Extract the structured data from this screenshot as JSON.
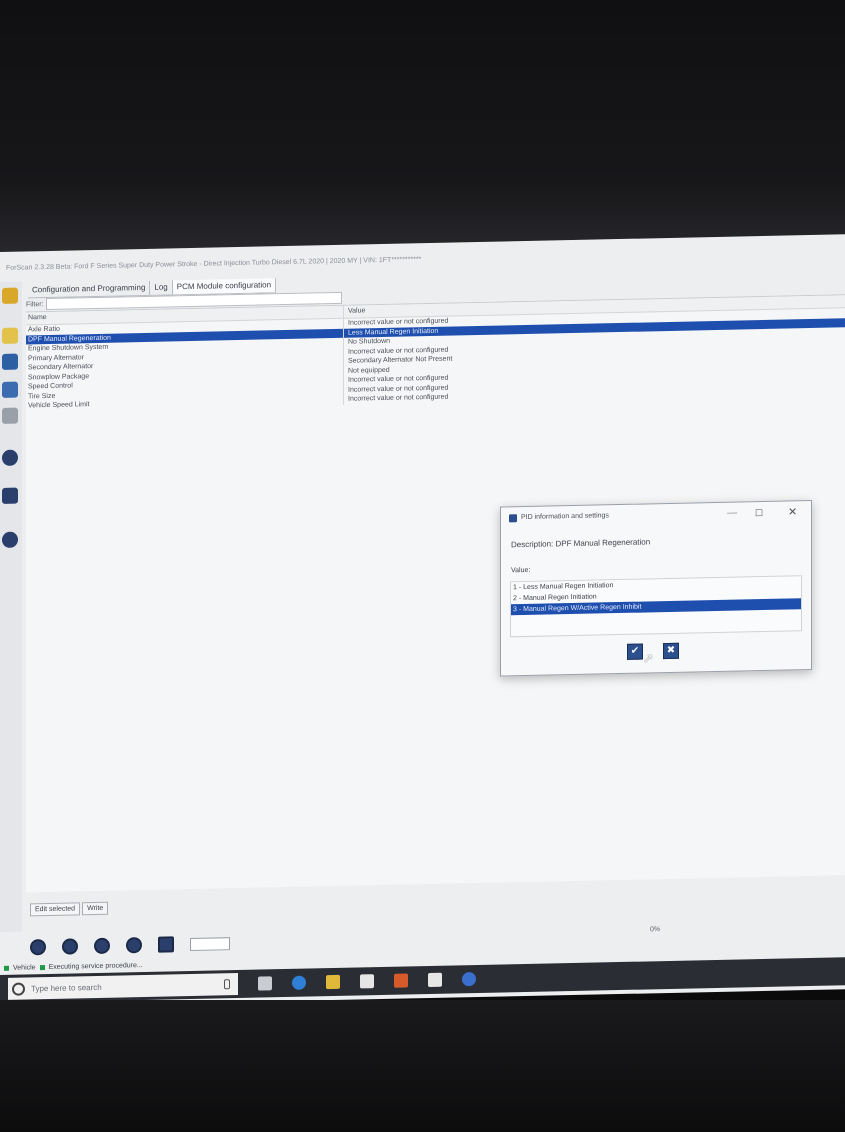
{
  "window": {
    "title": "ForScan 2.3.28 Beta: Ford F Series Super Duty Power Stroke - Direct Injection Turbo Diesel 6.7L 2020 | 2020 MY | VIN: 1FT***********"
  },
  "tabs": [
    {
      "label": "Configuration and Programming"
    },
    {
      "label": "Log"
    },
    {
      "label": "PCM Module configuration"
    }
  ],
  "filter": {
    "label": "Filter:",
    "value": ""
  },
  "grid": {
    "header": {
      "name": "Name",
      "value": "Value"
    },
    "rows": [
      {
        "name": "Axle Ratio",
        "value": "Incorrect value or not configured"
      },
      {
        "name": "DPF Manual Regeneration",
        "value": "Less Manual Regen Initiation"
      },
      {
        "name": "Engine Shutdown System",
        "value": "No Shutdown"
      },
      {
        "name": "Primary Alternator",
        "value": "Incorrect value or not configured"
      },
      {
        "name": "Secondary Alternator",
        "value": "Secondary Alternator Not Present"
      },
      {
        "name": "Snowplow Package",
        "value": "Not equipped"
      },
      {
        "name": "Speed Control",
        "value": "Incorrect value or not configured"
      },
      {
        "name": "Tire Size",
        "value": "Incorrect value or not configured"
      },
      {
        "name": "Vehicle Speed Limit",
        "value": "Incorrect value or not configured"
      }
    ],
    "selected_index": 1
  },
  "dialog": {
    "title": "PID information and settings",
    "description": "Description: DPF Manual Regeneration",
    "value_label": "Value:",
    "options": [
      "1 - Less Manual Regen Initiation",
      "2 - Manual Regen Initiation",
      "3 - Manual Regen W/Active Regen Inhibit"
    ],
    "selected_index": 2,
    "ok_glyph": "✔",
    "cancel_glyph": "✖",
    "minimize_glyph": "—",
    "maximize_glyph": "☐",
    "close_glyph": "✕"
  },
  "bottom_buttons": {
    "edit": "Edit selected",
    "write": "Write"
  },
  "progress": {
    "text": "0%"
  },
  "statusbar": {
    "vehicle": "Vehicle",
    "procedure": "Executing service procedure..."
  },
  "taskbar": {
    "search_placeholder": "Type here to search"
  },
  "colors": {
    "selection": "#1f4fae",
    "taskbar": "#2a2d33",
    "status_green": "#1e9a4a"
  }
}
